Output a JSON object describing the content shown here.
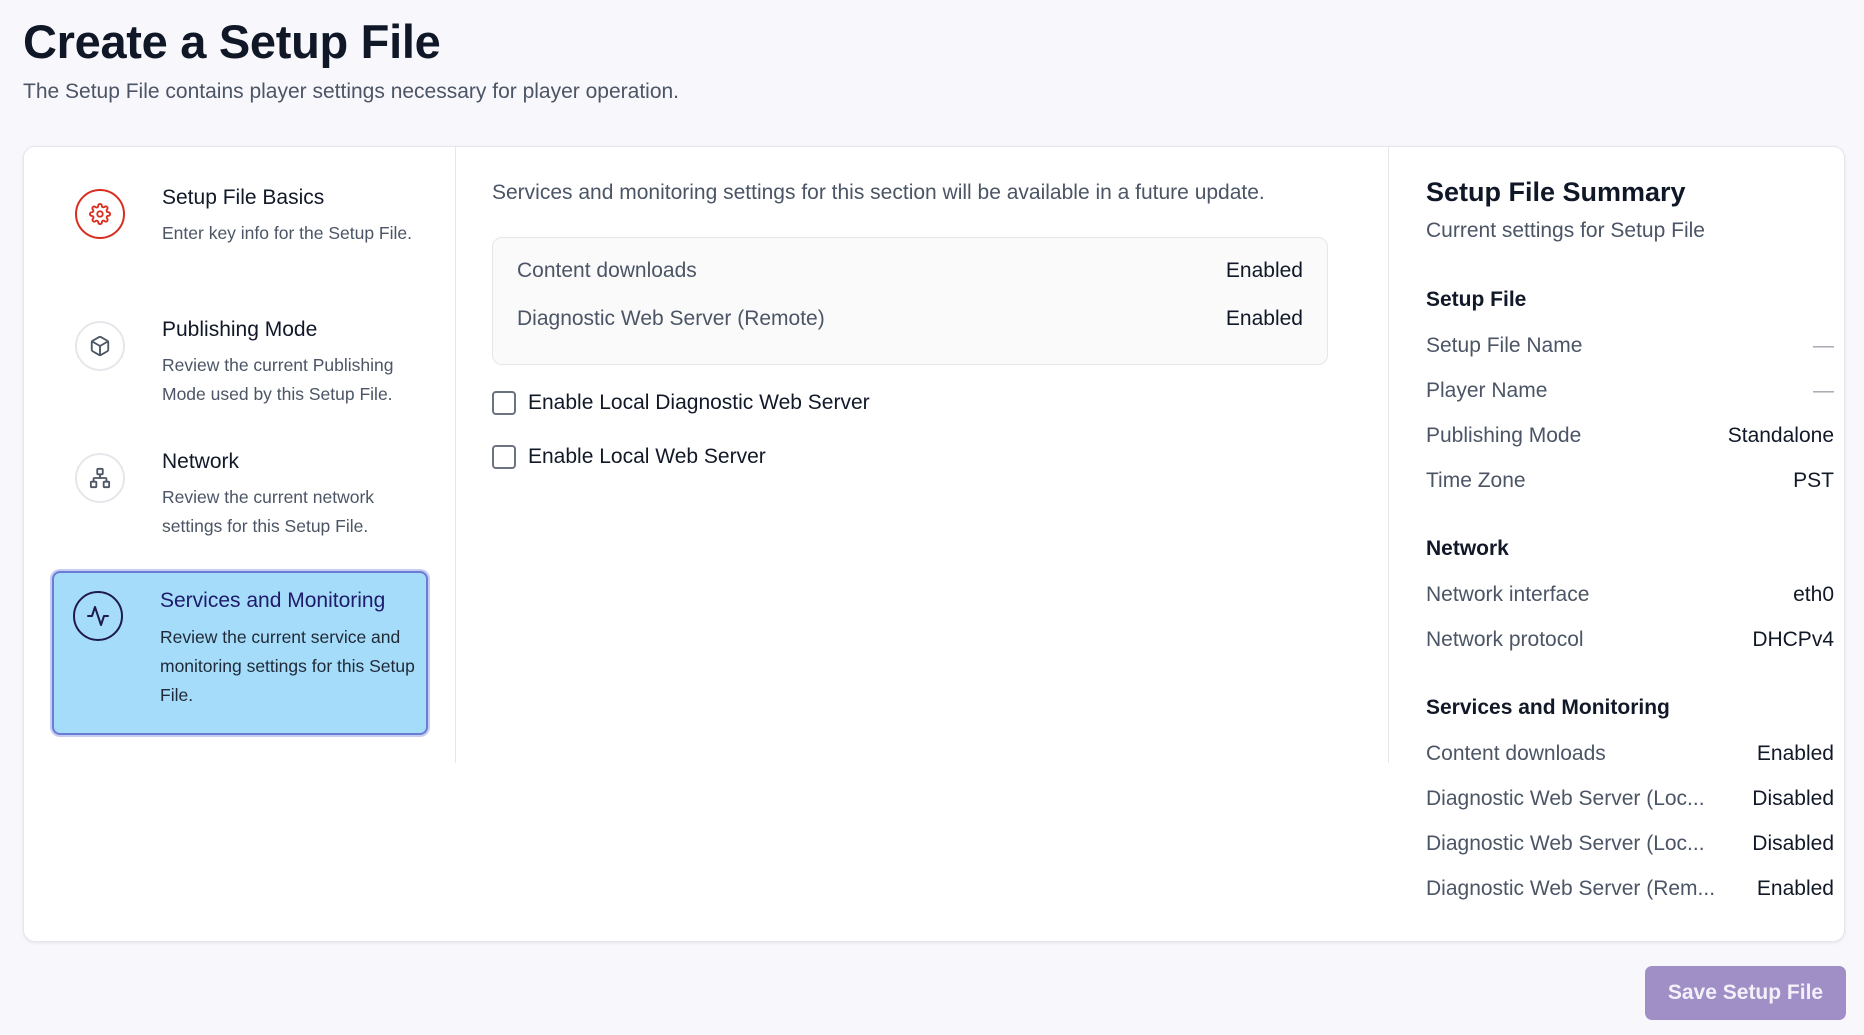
{
  "page": {
    "title": "Create a Setup File",
    "subtitle": "The Setup File contains player settings necessary for player operation."
  },
  "stepper": {
    "items": [
      {
        "title": "Setup File Basics",
        "desc": "Enter key info for the Setup File.",
        "icon": "gear-icon",
        "state": "error"
      },
      {
        "title": "Publishing Mode",
        "desc": "Review the current Publishing Mode used by this Setup File.",
        "icon": "cube-icon",
        "state": "default"
      },
      {
        "title": "Network",
        "desc": "Review the current network settings for this Setup File.",
        "icon": "network-icon",
        "state": "default"
      },
      {
        "title": "Services and Monitoring",
        "desc": "Review the current service and monitoring settings for this Setup File.",
        "icon": "activity-icon",
        "state": "active"
      }
    ]
  },
  "main": {
    "notice": "Services and monitoring settings for this section will be available in a future update.",
    "status": [
      {
        "label": "Content downloads",
        "value": "Enabled"
      },
      {
        "label": "Diagnostic Web Server (Remote)",
        "value": "Enabled"
      }
    ],
    "checkboxes": [
      {
        "label": "Enable Local Diagnostic Web Server",
        "checked": false
      },
      {
        "label": "Enable Local Web Server",
        "checked": false
      }
    ]
  },
  "summary": {
    "title": "Setup File Summary",
    "subtitle": "Current settings for Setup File",
    "sections": [
      {
        "heading": "Setup File",
        "rows": [
          {
            "key": "Setup File Name",
            "value": "—"
          },
          {
            "key": "Player Name",
            "value": "—"
          },
          {
            "key": "Publishing Mode",
            "value": "Standalone"
          },
          {
            "key": "Time Zone",
            "value": "PST"
          }
        ]
      },
      {
        "heading": "Network",
        "rows": [
          {
            "key": "Network interface",
            "value": "eth0"
          },
          {
            "key": "Network protocol",
            "value": "DHCPv4"
          }
        ]
      },
      {
        "heading": "Services and Monitoring",
        "rows": [
          {
            "key": "Content downloads",
            "value": "Enabled"
          },
          {
            "key": "Diagnostic Web Server (Loc...",
            "value": "Disabled"
          },
          {
            "key": "Diagnostic Web Server (Loc...",
            "value": "Disabled"
          },
          {
            "key": "Diagnostic Web Server (Rem...",
            "value": "Enabled"
          }
        ]
      }
    ]
  },
  "footer": {
    "save_label": "Save Setup File"
  },
  "colors": {
    "error": "#d92d20",
    "active_bg": "#a5dcfa",
    "active_border": "#6b7cd4",
    "primary_button": "#9f8fc6"
  }
}
